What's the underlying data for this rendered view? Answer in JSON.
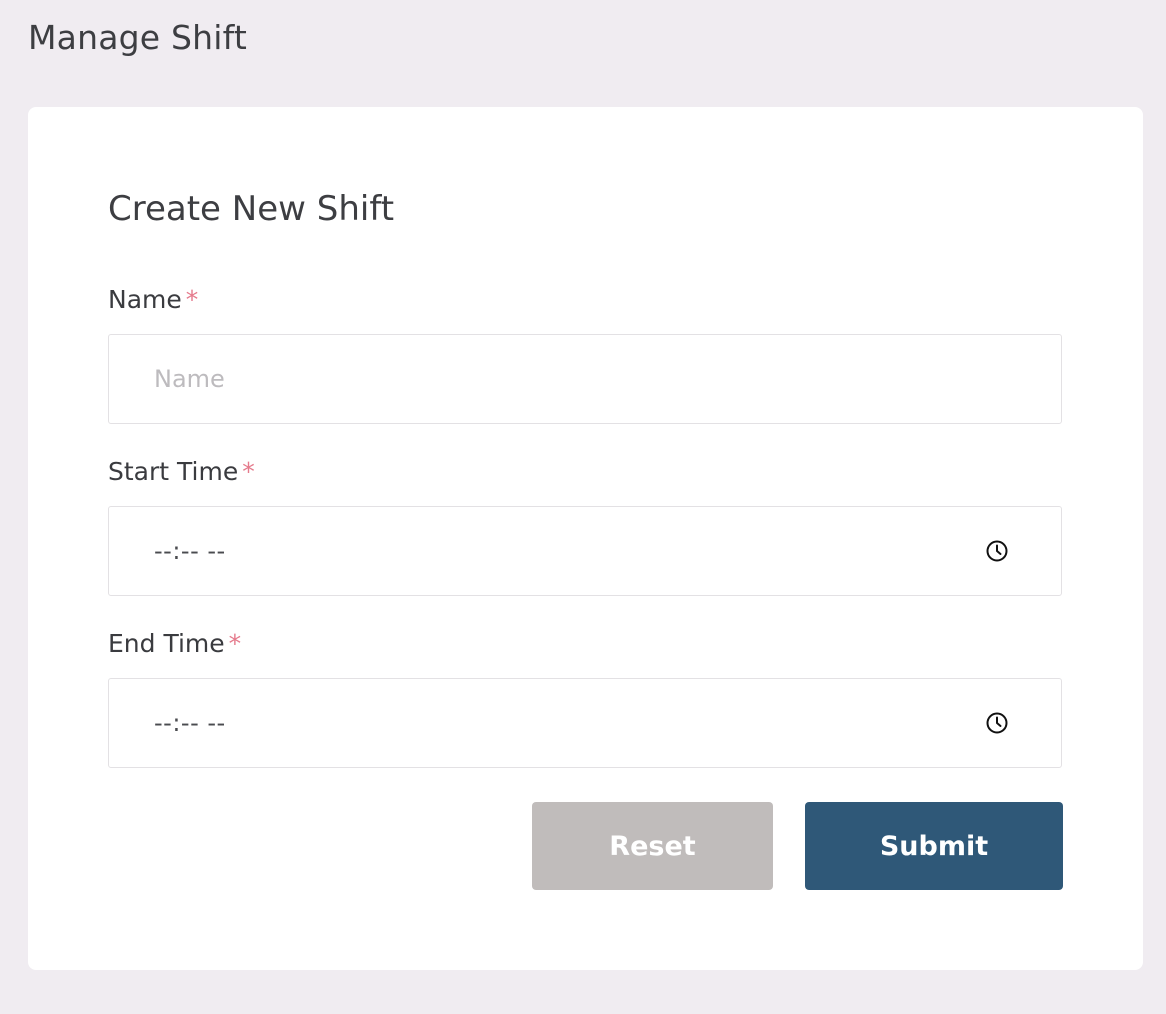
{
  "page": {
    "title": "Manage Shift"
  },
  "form": {
    "title": "Create New Shift",
    "required_marker": "*",
    "name": {
      "label": "Name",
      "placeholder": "Name",
      "value": ""
    },
    "start_time": {
      "label": "Start Time",
      "display": "--:-- --",
      "icon": "clock-icon"
    },
    "end_time": {
      "label": "End Time",
      "display": "--:-- --",
      "icon": "clock-icon"
    },
    "reset_label": "Reset",
    "submit_label": "Submit"
  },
  "colors": {
    "background": "#f0ecf1",
    "card": "#ffffff",
    "required": "#e57a8c",
    "reset_button": "#c0bcbb",
    "submit_button": "#2f5878"
  }
}
